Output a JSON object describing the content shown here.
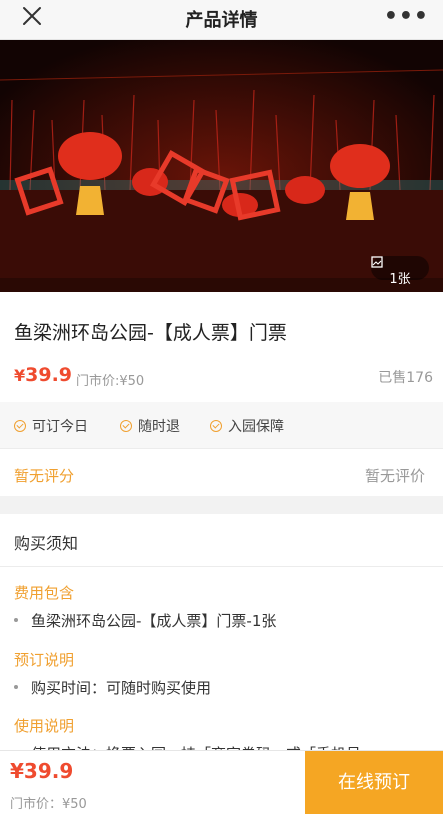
{
  "header": {
    "title": "产品详情",
    "close_icon": "close-icon",
    "more_icon": "more-icon",
    "more_glyph": "•••"
  },
  "gallery": {
    "photo_count": "1张",
    "icon": "image-icon"
  },
  "product": {
    "name": "鱼梁洲环岛公园-【成人票】门票",
    "price_symbol": "¥",
    "price_value": "39.9",
    "market_price": "门市价:¥50",
    "sold": "已售176"
  },
  "tags": [
    "可订今日",
    "随时退",
    "入园保障"
  ],
  "rating": {
    "score": "暂无评分",
    "reviews": "暂无评价"
  },
  "notice": {
    "title": "购买须知",
    "sections": [
      {
        "title": "费用包含",
        "items": [
          "鱼梁洲环岛公园-【成人票】门票-1张"
        ]
      },
      {
        "title": "预订说明",
        "items": [
          "购买时间：可随时购买使用"
        ]
      },
      {
        "title": "使用说明",
        "items": [
          "使用方法：换票入园，持「商家卷码」或「手机号」"
        ]
      }
    ]
  },
  "bottom": {
    "price": "¥39.9",
    "market_price": "门市价：¥50",
    "book_button": "在线预订"
  },
  "colors": {
    "accent": "#f5a623",
    "price": "#ef4b2f",
    "tag_check": "#f0a030"
  }
}
